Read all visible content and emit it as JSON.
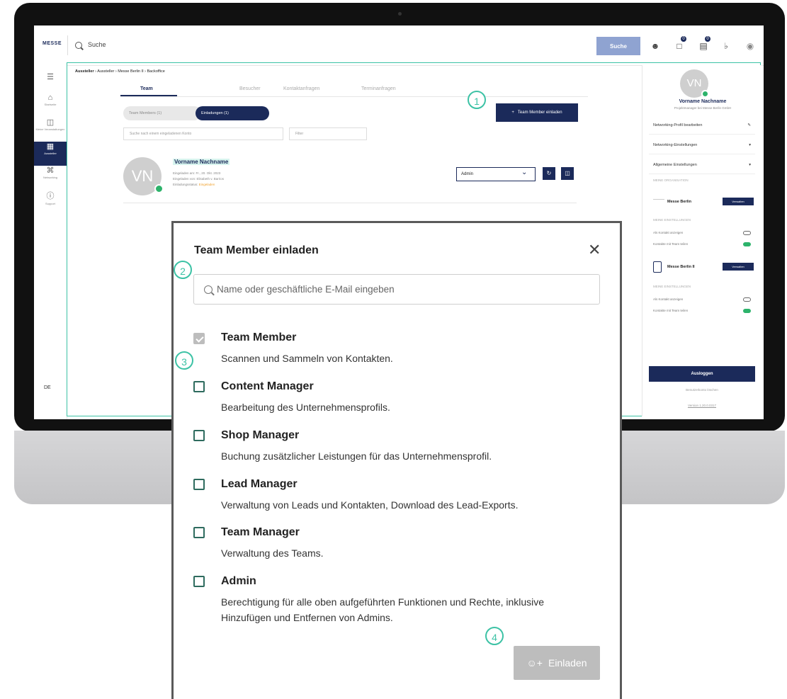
{
  "topbar": {
    "logo": "MESSE",
    "search_placeholder": "Suche",
    "search_button": "Suche",
    "badges": {
      "chat": "0",
      "cart": "0"
    }
  },
  "leftnav": {
    "items": [
      {
        "label": "Startseite",
        "icon": "home-icon"
      },
      {
        "label": "Meine Veranstaltungen",
        "icon": "calendar-icon"
      },
      {
        "label": "Aussteller",
        "icon": "grid-icon"
      },
      {
        "label": "Networking",
        "icon": "network-icon"
      },
      {
        "label": "Support",
        "icon": "help-icon"
      }
    ],
    "language": "DE"
  },
  "breadcrumb": [
    "Aussteller",
    "Aussteller",
    "Messe Berlin II",
    "Backoffice"
  ],
  "tabs": [
    "Team",
    "Besucher",
    "Kontaktanfragen",
    "Terminanfragen"
  ],
  "chips": {
    "members": "Team Members (1)",
    "invitations": "Einladungen (1)"
  },
  "list_search_placeholder": "Suche nach einem eingeladenen Konto",
  "filter_placeholder": "Filter",
  "invite_button": "Team Member einladen",
  "member": {
    "initials": "VN",
    "name": "Vorname Nachname",
    "invited_on": "Eingeladen am: Fr., 20. Okt. 2023",
    "invited_by": "Eingeladen von: Elisabeth v. Barrios",
    "status_label": "Einladungsstatus:",
    "status_value": "Eingeladen",
    "role": "Admin"
  },
  "right_panel": {
    "initials": "VN",
    "name": "Vorname Nachname",
    "subtitle": "Projektmanager bei Messe Berlin GmbH",
    "menu": [
      "Networking-Profil bearbeiten",
      "Networking-Einstellungen",
      "Allgemeine Einstellungen"
    ],
    "section_orgs": "MEINE ORGANISATION",
    "orgs": [
      {
        "name": "Messe Berlin",
        "manage": "Verwalten",
        "settings_title": "MEINE EINSTELLUNGEN",
        "contact_label": "Als Kontakt anzeigen",
        "share_label": "Kontakte mit Team teilen"
      },
      {
        "name": "Messe Berlin II",
        "manage": "Verwalten",
        "settings_title": "MEINE EINSTELLUNGEN",
        "contact_label": "Als Kontakt anzeigen",
        "share_label": "Kontakte mit Team teilen"
      }
    ],
    "logout": "Ausloggen",
    "delete_account": "Benutzerkonto löschen",
    "version": "Version 1.20.0.0317"
  },
  "callouts": [
    "1",
    "2",
    "3",
    "4"
  ],
  "modal": {
    "title": "Team Member einladen",
    "search_placeholder": "Name oder geschäftliche E-Mail eingeben",
    "roles": [
      {
        "title": "Team Member",
        "desc": "Scannen und Sammeln von Kontakten.",
        "checked": true
      },
      {
        "title": "Content Manager",
        "desc": "Bearbeitung des Unternehmensprofils.",
        "checked": false
      },
      {
        "title": "Shop Manager",
        "desc": "Buchung zusätzlicher Leistungen für das Unternehmensprofil.",
        "checked": false
      },
      {
        "title": "Lead Manager",
        "desc": "Verwaltung von Leads und Kontakten, Download des Lead-Exports.",
        "checked": false
      },
      {
        "title": "Team Manager",
        "desc": "Verwaltung des Teams.",
        "checked": false
      },
      {
        "title": "Admin",
        "desc": "Berechtigung für alle oben aufgeführten Funktionen und Rechte, inklusive Hinzufügen und Entfernen von Admins.",
        "checked": false
      }
    ],
    "submit": "Einladen"
  },
  "colors": {
    "brand": "#1b2a5a",
    "accent": "#3cc2a5",
    "online": "#2db36b",
    "disabled": "#bdbdbd"
  }
}
